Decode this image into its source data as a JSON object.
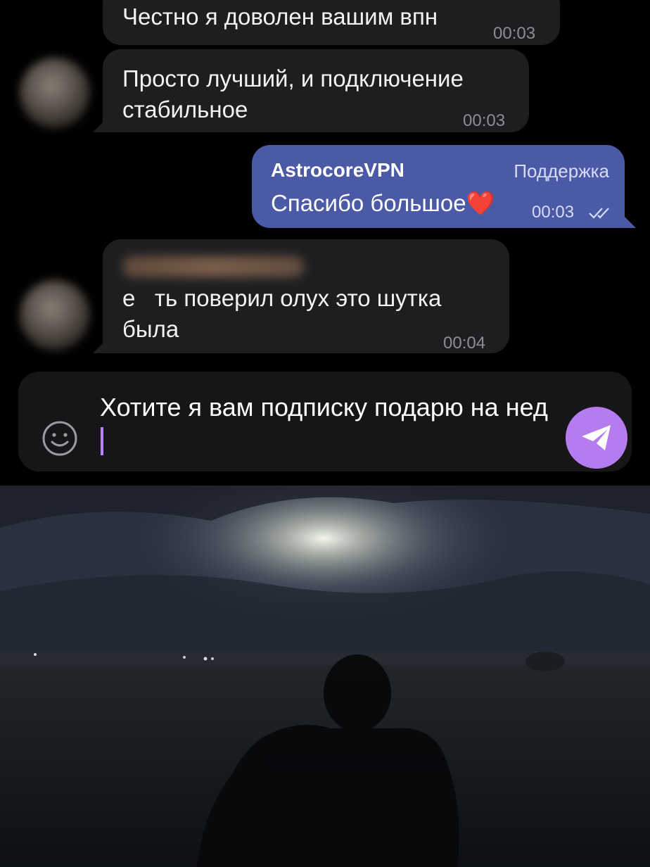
{
  "messages": [
    {
      "text": "Честно я доволен вашим впн",
      "time": "00:03"
    },
    {
      "text": "Просто лучший, и подключение стабильное",
      "time": "00:03"
    },
    {
      "sender": "AstrocoreVPN",
      "badge": "Поддержка",
      "text": "Спасибо большое",
      "emoji": "❤️",
      "time": "00:03",
      "status": "read"
    },
    {
      "text": "е   ть поверил олух это шутка была",
      "time": "00:04"
    }
  ],
  "composer": {
    "value": "Хотите я вам подписку подарю на нед",
    "emoji_icon": "smile-icon",
    "send_icon": "paper-plane-icon"
  },
  "colors": {
    "incoming_bubble": "#1e1e21",
    "outgoing_bubble": "#4b5aa6",
    "send_button": "#b77bf0",
    "caret": "#b982ff"
  }
}
